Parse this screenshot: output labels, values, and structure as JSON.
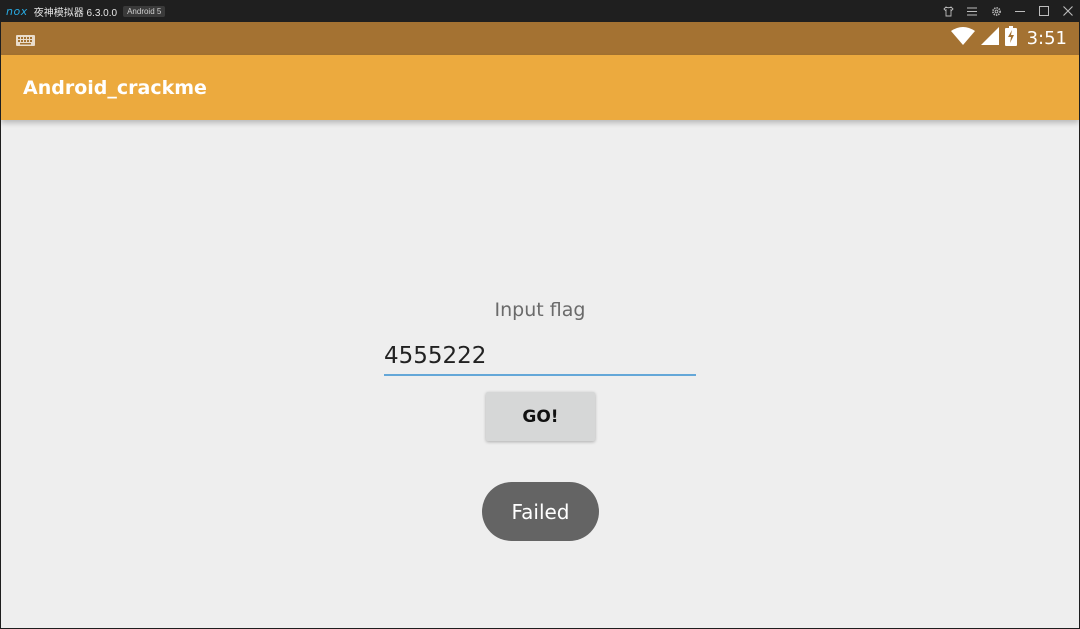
{
  "emulator": {
    "logo": "nox",
    "title": "夜神模拟器 6.3.0.0",
    "badge": "Android 5",
    "controls": [
      "shirt-icon",
      "menu-icon",
      "gear-icon",
      "minimize-icon",
      "maximize-icon",
      "close-icon"
    ]
  },
  "status_bar": {
    "left_icon": "keyboard-icon",
    "icons": [
      "wifi-icon",
      "signal-icon",
      "battery-charging-icon"
    ],
    "time": "3:51"
  },
  "app_bar": {
    "title": "Android_crackme"
  },
  "main": {
    "prompt": "Input flag",
    "flag_input": {
      "value": "4555222"
    },
    "go_button_label": "GO!",
    "toast": "Failed"
  },
  "colors": {
    "status_bar": "#a47232",
    "app_bar": "#ecaa3e",
    "background": "#eeeeee",
    "input_underline": "#64a7d8",
    "button": "#d6d7d7",
    "toast": "#646464"
  }
}
